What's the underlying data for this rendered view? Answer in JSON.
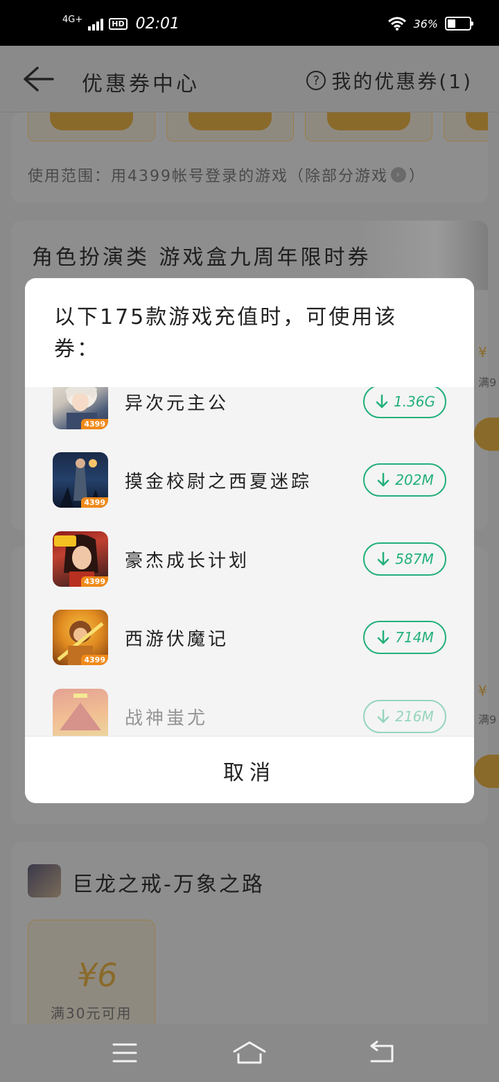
{
  "status": {
    "network": "4G+",
    "hd": "HD",
    "time": "02:01",
    "battery_text": "36%",
    "battery_level": 0.36
  },
  "header": {
    "title": "优惠券中心",
    "my_coupons": "我的优惠券(1)"
  },
  "background": {
    "scope_text": "使用范围：用4399帐号登录的游戏（除部分游戏",
    "card2_title": "角色扮演类  游戏盒九周年限时券",
    "card3_title": "巨龙之戒-万象之路",
    "coupon_amount": "¥6",
    "coupon_condition": "满30元可用",
    "peek_symbol": "¥",
    "peek_text": "满9"
  },
  "modal": {
    "message": "以下175款游戏充值时，可使用该券：",
    "games": [
      {
        "name": "异次元主公",
        "size": "1.36G",
        "badge": "4399"
      },
      {
        "name": "摸金校尉之西夏迷踪",
        "size": "202M",
        "badge": "4399"
      },
      {
        "name": "豪杰成长计划",
        "size": "587M",
        "badge": "4399"
      },
      {
        "name": "西游伏魔记",
        "size": "714M",
        "badge": "4399"
      },
      {
        "name": "战神蚩尤",
        "size": "216M",
        "badge": ""
      }
    ],
    "cancel": "取消"
  },
  "colors": {
    "accent_green": "#23b07a",
    "coupon_orange": "#f0a020",
    "overlay_gray": "#8a8a8a"
  }
}
